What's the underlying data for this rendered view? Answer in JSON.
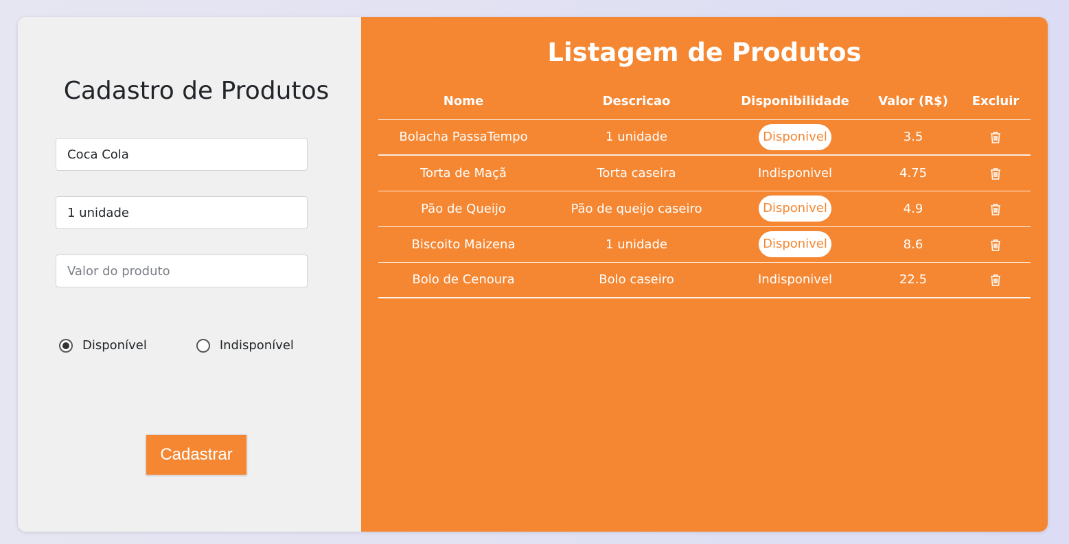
{
  "form": {
    "title": "Cadastro de Produtos",
    "name_value": "Coca Cola",
    "desc_value": "1 unidade",
    "price_value": "",
    "price_placeholder": "Valor do produto",
    "radio_available": "Disponível",
    "radio_unavailable": "Indisponível",
    "selected": "available",
    "submit_label": "Cadastrar"
  },
  "listing": {
    "title": "Listagem de Produtos",
    "headers": [
      "Nome",
      "Descricao",
      "Disponibilidade",
      "Valor (R$)",
      "Excluir"
    ],
    "rows": [
      {
        "nome": "Bolacha PassaTempo",
        "descricao": "1 unidade",
        "disponibilidade": "Disponivel",
        "valor": "3.5"
      },
      {
        "nome": "Torta de Maçã",
        "descricao": "Torta caseira",
        "disponibilidade": "Indisponivel",
        "valor": "4.75"
      },
      {
        "nome": "Pão de Queijo",
        "descricao": "Pão de queijo caseiro",
        "disponibilidade": "Disponivel",
        "valor": "4.9"
      },
      {
        "nome": "Biscoito Maizena",
        "descricao": "1 unidade",
        "disponibilidade": "Disponivel",
        "valor": "8.6"
      },
      {
        "nome": "Bolo de Cenoura",
        "descricao": "Bolo caseiro",
        "disponibilidade": "Indisponivel",
        "valor": "22.5"
      }
    ],
    "delete_icon": "trash-icon"
  },
  "colors": {
    "accent": "#f58733",
    "form_bg": "#f0f0f0",
    "text_dark": "#212529"
  }
}
